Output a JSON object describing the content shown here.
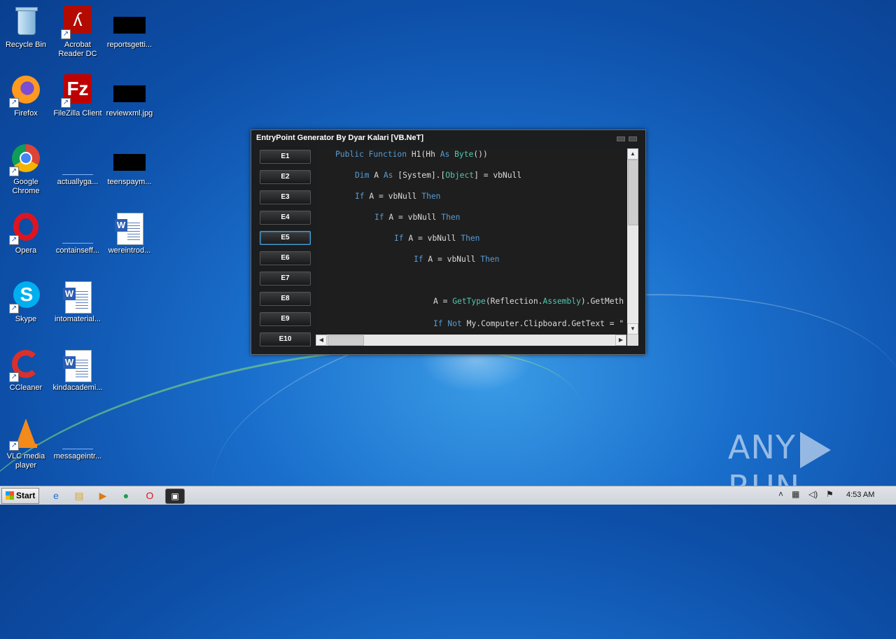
{
  "desktop": {
    "icons": [
      {
        "label": "Recycle Bin"
      },
      {
        "label": "Acrobat Reader DC"
      },
      {
        "label": "reportsgetti..."
      },
      {
        "label": "Firefox"
      },
      {
        "label": "FileZilla Client"
      },
      {
        "label": "reviewxml.jpg"
      },
      {
        "label": "Google Chrome"
      },
      {
        "label": "actuallyga..."
      },
      {
        "label": "teenspaym..."
      },
      {
        "label": "Opera"
      },
      {
        "label": "containseff..."
      },
      {
        "label": "wereintrod..."
      },
      {
        "label": "Skype"
      },
      {
        "label": "intomaterial..."
      },
      {
        "label": "CCleaner"
      },
      {
        "label": "kindacademi..."
      },
      {
        "label": "VLC media player"
      },
      {
        "label": "messageintr..."
      }
    ]
  },
  "window": {
    "title": "EntryPoint Generator By Dyar Kalari [VB.NeT]",
    "buttons": [
      "E1",
      "E2",
      "E3",
      "E4",
      "E5",
      "E6",
      "E7",
      "E8",
      "E9",
      "E10"
    ],
    "active_button": "E5",
    "code_lines": [
      "Public Function H1(Hh As Byte())",
      "Dim A As [System].[Object] = vbNull",
      "If A = vbNull Then",
      "If A = vbNull Then",
      "If A = vbNull Then",
      "If A = vbNull Then",
      "",
      "A = GetType(Reflection.Assembly).GetMeth",
      "If Not My.Computer.Clipboard.GetText = \""
    ]
  },
  "watermark": {
    "left": "ANY",
    "right": "RUN"
  },
  "taskbar": {
    "start_label": "Start",
    "clock": "4:53 AM"
  },
  "colors": {
    "keyword": "#569cd6",
    "type": "#4ec9b0",
    "active_button_border": "#4aa3df"
  }
}
